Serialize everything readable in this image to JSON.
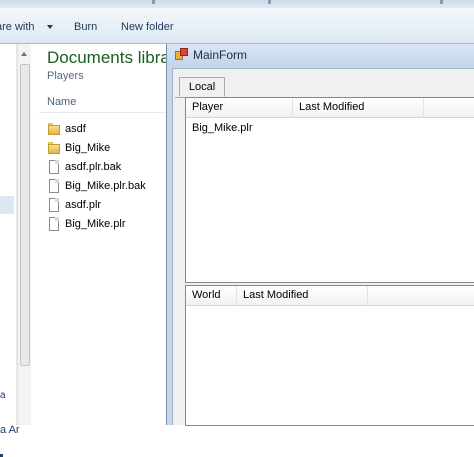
{
  "explorer": {
    "toolbar": {
      "share_with": "are with",
      "burn": "Burn",
      "new_folder": "New folder"
    },
    "navpane": {
      "fragment_1": "a",
      "fragment_2": "a Ar"
    },
    "library_title": "Documents libra",
    "library_subtitle": "Players",
    "column_name": "Name",
    "files": [
      {
        "name": "asdf",
        "icon": "folder-icon"
      },
      {
        "name": "Big_Mike",
        "icon": "folder-icon"
      },
      {
        "name": "asdf.plr.bak",
        "icon": "document-icon"
      },
      {
        "name": "Big_Mike.plr.bak",
        "icon": "document-icon"
      },
      {
        "name": "asdf.plr",
        "icon": "document-icon"
      },
      {
        "name": "Big_Mike.plr",
        "icon": "document-icon"
      }
    ]
  },
  "mainform": {
    "title": "MainForm",
    "tab_local": "Local",
    "players_list": {
      "columns": [
        "Player",
        "Last Modified"
      ],
      "rows": [
        {
          "player": "Big_Mike.plr",
          "last_modified": ""
        }
      ]
    },
    "worlds_list": {
      "columns": [
        "World",
        "Last Modified"
      ],
      "rows": []
    }
  },
  "colors": {
    "library_title": "#1e5d1e",
    "dialog_frame": "#c5d6ea",
    "toolbar_text": "#1e395b"
  }
}
